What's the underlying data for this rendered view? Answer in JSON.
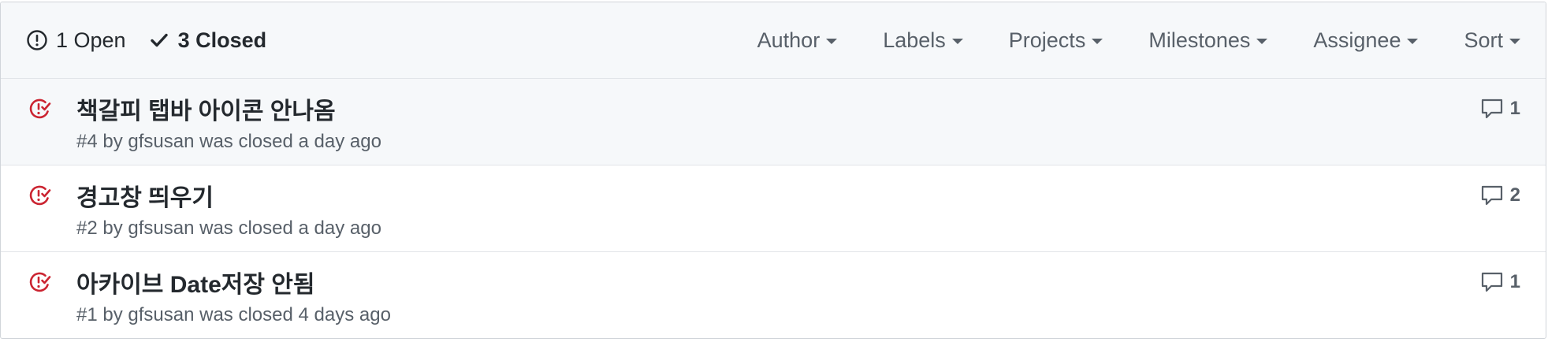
{
  "header": {
    "open_label": "1 Open",
    "closed_label": "3 Closed",
    "filters": [
      "Author",
      "Labels",
      "Projects",
      "Milestones",
      "Assignee",
      "Sort"
    ]
  },
  "issues": [
    {
      "title": "책갈피 탭바 아이콘 안나옴",
      "meta": "#4 by gfsusan was closed a day ago",
      "comments": "1"
    },
    {
      "title": "경고창 띄우기",
      "meta": "#2 by gfsusan was closed a day ago",
      "comments": "2"
    },
    {
      "title": "아카이브 Date저장 안됨",
      "meta": "#1 by gfsusan was closed 4 days ago",
      "comments": "1"
    }
  ],
  "colors": {
    "closed_icon": "#cb2431",
    "text_primary": "#24292e",
    "text_muted": "#586069",
    "header_bg": "#f6f8fa",
    "border": "#d1d5da"
  },
  "icons": {
    "open_state": "issue-opened-icon",
    "closed_state": "check-icon",
    "issue_closed": "issue-closed-icon",
    "comment": "comment-icon",
    "dropdown": "caret-down-icon"
  }
}
